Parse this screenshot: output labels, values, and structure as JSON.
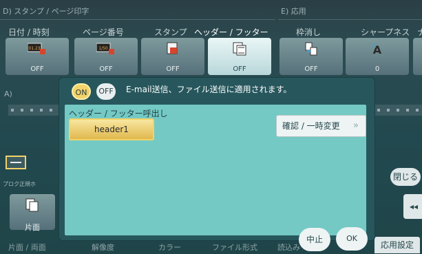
{
  "background": {
    "section_left": "D) スタンプ / ページ印字",
    "section_right": "E) 応用",
    "section_a": "A)",
    "tabs": [
      "日付 / 時刻",
      "ページ番号",
      "スタンプ",
      "ヘッダー / フッター",
      "枠消し",
      "シャープネス",
      "ナ"
    ],
    "tiles": [
      {
        "value": "OFF",
        "icon": "date-time-icon",
        "badge": "01.23"
      },
      {
        "value": "OFF",
        "icon": "page-number-icon",
        "badge": "1/50"
      },
      {
        "value": "OFF",
        "icon": "stamp-icon"
      },
      {
        "value": "OFF",
        "icon": "header-footer-icon"
      },
      {
        "value": "OFF",
        "icon": "frame-erase-icon"
      },
      {
        "value": "0",
        "icon": "sharpness-icon"
      }
    ],
    "side_label": "プロク正規ホ",
    "close_label": "閉じる",
    "duplex_tile_label": "片面",
    "bottom_tabs": [
      "片面 / 両面",
      "解像度",
      "カラー",
      "ファイル形式",
      "読込み"
    ],
    "advanced_settings": "応用設定",
    "back_arrow": "◂◂"
  },
  "modal": {
    "on_label": "ON",
    "off_label": "OFF",
    "notice": "E-mail送信、ファイル送信に適用されます。",
    "section_title": "ヘッダー / フッター呼出し",
    "selected_item": "header1",
    "confirm_button": "確認 / 一時変更",
    "confirm_arrow": "»",
    "cancel_button": "中止",
    "ok_button": "OK"
  },
  "colors": {
    "accent_yellow": "#f2d36a",
    "modal_panel": "#74c9c4",
    "modal_frame": "#27575d",
    "background": "#2b4a50"
  }
}
